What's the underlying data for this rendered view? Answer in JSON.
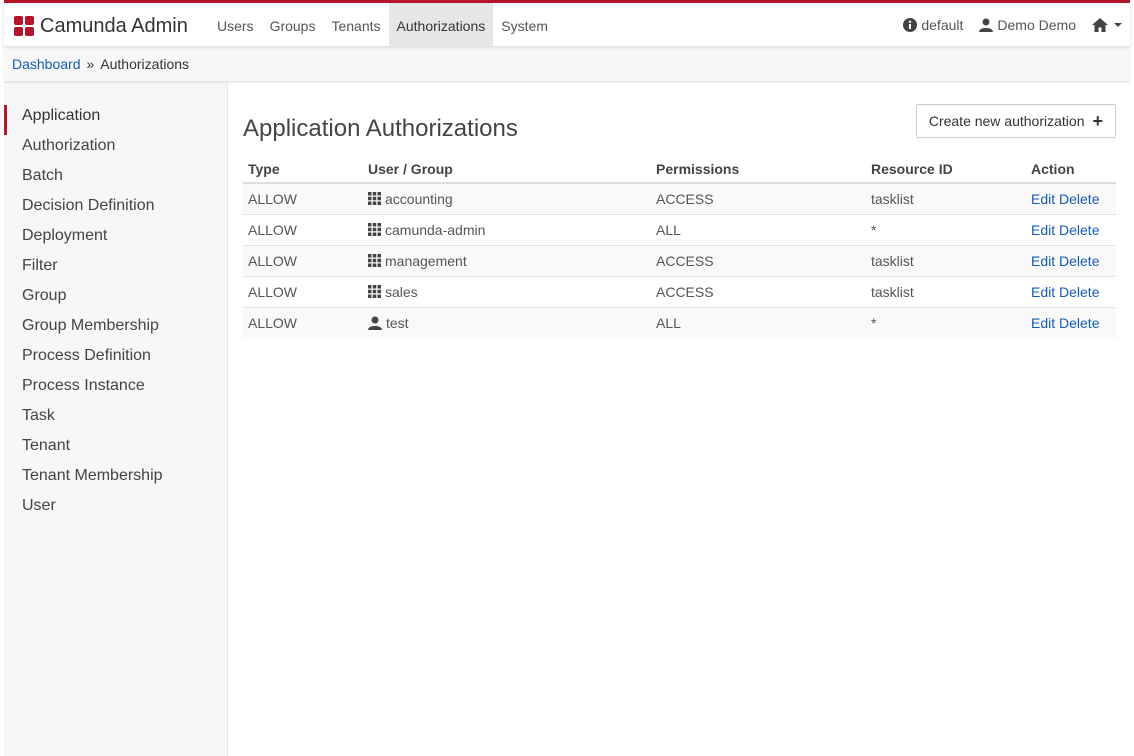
{
  "app": {
    "name": "Camunda Admin",
    "brand_color": "#b5152b"
  },
  "nav": {
    "items": [
      "Users",
      "Groups",
      "Tenants",
      "Authorizations",
      "System"
    ],
    "active": "Authorizations"
  },
  "right_nav": {
    "engine": "default",
    "user": "Demo Demo",
    "home_icon": "home-icon"
  },
  "breadcrumb": {
    "home": "Dashboard",
    "separator": "»",
    "current": "Authorizations"
  },
  "sidebar": {
    "items": [
      "Application",
      "Authorization",
      "Batch",
      "Decision Definition",
      "Deployment",
      "Filter",
      "Group",
      "Group Membership",
      "Process Definition",
      "Process Instance",
      "Task",
      "Tenant",
      "Tenant Membership",
      "User"
    ],
    "active": "Application"
  },
  "main": {
    "title": "Application Authorizations",
    "create_label": "Create new authorization",
    "create_icon": "+",
    "columns": [
      "Type",
      "User / Group",
      "Permissions",
      "Resource ID",
      "Action"
    ],
    "rows": [
      {
        "type": "ALLOW",
        "icon": "group-icon",
        "name": "accounting",
        "permissions": "ACCESS",
        "resource": "tasklist",
        "edit": "Edit",
        "delete": "Delete"
      },
      {
        "type": "ALLOW",
        "icon": "group-icon",
        "name": "camunda-admin",
        "permissions": "ALL",
        "resource": "*",
        "edit": "Edit",
        "delete": "Delete"
      },
      {
        "type": "ALLOW",
        "icon": "group-icon",
        "name": "management",
        "permissions": "ACCESS",
        "resource": "tasklist",
        "edit": "Edit",
        "delete": "Delete"
      },
      {
        "type": "ALLOW",
        "icon": "group-icon",
        "name": "sales",
        "permissions": "ACCESS",
        "resource": "tasklist",
        "edit": "Edit",
        "delete": "Delete"
      },
      {
        "type": "ALLOW",
        "icon": "user-icon",
        "name": "test",
        "permissions": "ALL",
        "resource": "*",
        "edit": "Edit",
        "delete": "Delete"
      }
    ]
  }
}
